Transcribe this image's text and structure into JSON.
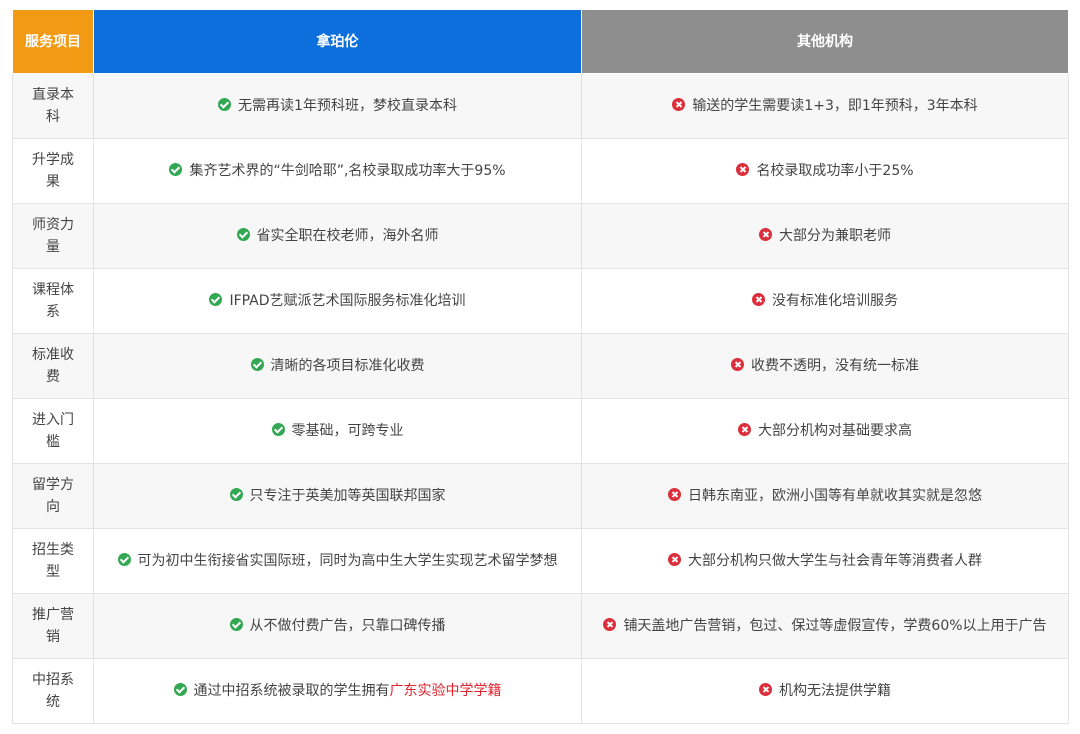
{
  "header": {
    "col_service": "服务项目",
    "col_napolun": "拿珀伦",
    "col_others": "其他机构"
  },
  "colors": {
    "service_header": "#f29a14",
    "napolun_header": "#0d6fdc",
    "others_header": "#8e8e8e",
    "check": "#33a853",
    "cross": "#dc2e3b",
    "highlight_text": "#e2232f"
  },
  "icons": {
    "good": "check-circle-icon",
    "bad": "x-circle-icon"
  },
  "rows": [
    {
      "item": "直录本科",
      "napolun": "无需再读1年预科班，梦校直录本科",
      "others": "输送的学生需要读1+3，即1年预科，3年本科"
    },
    {
      "item": "升学成果",
      "napolun": "集齐艺术界的“牛剑哈耶”,名校录取成功率大于95%",
      "others": "名校录取成功率小于25%"
    },
    {
      "item": "师资力量",
      "napolun": "省实全职在校老师，海外名师",
      "others": "大部分为兼职老师"
    },
    {
      "item": "课程体系",
      "napolun": "IFPAD艺赋派艺术国际服务标准化培训",
      "others": "没有标准化培训服务"
    },
    {
      "item": "标准收费",
      "napolun": "清晰的各项目标准化收费",
      "others": "收费不透明，没有统一标准"
    },
    {
      "item": "进入门槛",
      "napolun": "零基础，可跨专业",
      "others": "大部分机构对基础要求高"
    },
    {
      "item": "留学方向",
      "napolun": "只专注于英美加等英国联邦国家",
      "others": "日韩东南亚，欧洲小国等有单就收其实就是忽悠"
    },
    {
      "item": "招生类型",
      "napolun": "可为初中生衔接省实国际班，同时为高中生大学生实现艺术留学梦想",
      "others": "大部分机构只做大学生与社会青年等消费者人群"
    },
    {
      "item": "推广营销",
      "napolun": "从不做付费广告，只靠口碑传播",
      "others": "铺天盖地广告营销，包过、保过等虚假宣传，学费60%以上用于广告"
    },
    {
      "item": "中招系统",
      "napolun": "通过中招系统被录取的学生拥有",
      "napolun_highlight": "广东实验中学学籍",
      "others": "机构无法提供学籍"
    }
  ]
}
